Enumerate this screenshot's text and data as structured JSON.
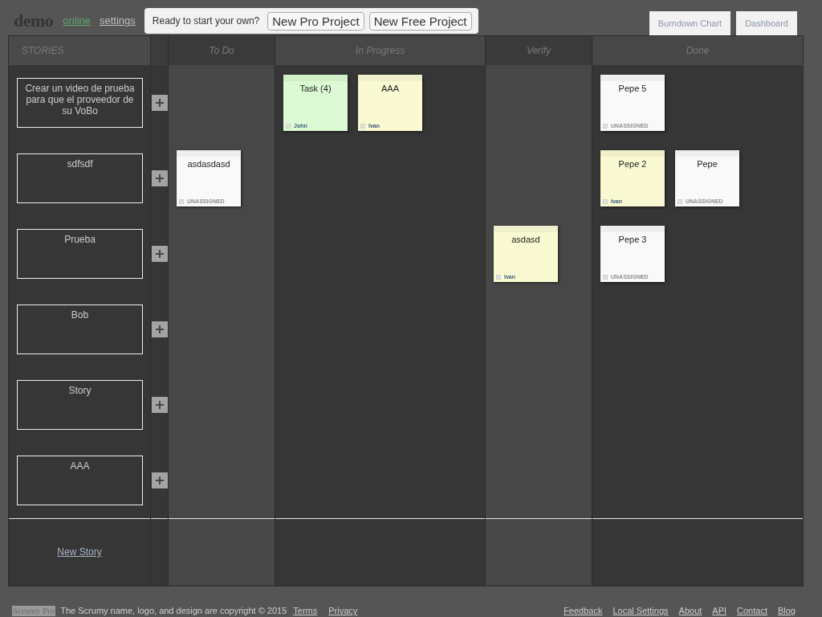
{
  "header": {
    "logo": "demo",
    "status_link": "online",
    "settings_link": "settings"
  },
  "promo": {
    "text": "Ready to start your own?",
    "buttons": [
      "New Pro Project",
      "New Free Project"
    ]
  },
  "view_tabs": [
    "Burndown Chart",
    "Dashboard"
  ],
  "board": {
    "stories_heading": "STORIES",
    "columns": [
      "To Do",
      "In Progress",
      "Verify",
      "Done"
    ],
    "rows": [
      {
        "story": "Crear un video de prueba para que el proveedor de su VoBo",
        "cells": [
          {},
          {
            "tasks": [
              {
                "title": "Task (4)",
                "assignee": "John",
                "assigned": true,
                "color": "#dcfad4"
              },
              {
                "title": "AAA",
                "assignee": "Ivan",
                "assigned": true,
                "color": "#fafad2"
              }
            ]
          },
          {},
          {
            "tasks": [
              {
                "title": "Pepe 5",
                "assignee": "UNASSIGNED",
                "assigned": false,
                "color": "#f9f9f9"
              }
            ]
          }
        ]
      },
      {
        "story": "sdfsdf",
        "cells": [
          {
            "tasks": [
              {
                "title": "asdasdasd",
                "assignee": "UNASSIGNED",
                "assigned": false,
                "color": "#f9f9f9"
              }
            ]
          },
          {},
          {},
          {
            "tasks": [
              {
                "title": "Pepe 2",
                "assignee": "Ivan",
                "assigned": true,
                "color": "#fafad2"
              },
              {
                "title": "Pepe",
                "assignee": "UNASSIGNED",
                "assigned": false,
                "color": "#f9f9f9"
              }
            ]
          }
        ]
      },
      {
        "story": "Prueba",
        "cells": [
          {},
          {},
          {
            "tasks": [
              {
                "title": "asdasd",
                "assignee": "Ivan",
                "assigned": true,
                "color": "#fafad2"
              }
            ]
          },
          {
            "tasks": [
              {
                "title": "Pepe 3",
                "assignee": "UNASSIGNED",
                "assigned": false,
                "color": "#f9f9f9"
              }
            ]
          }
        ]
      },
      {
        "story": "Bob",
        "cells": [
          {},
          {},
          {},
          {}
        ]
      },
      {
        "story": "Story",
        "cells": [
          {},
          {},
          {},
          {}
        ]
      },
      {
        "story": "AAA",
        "cells": [
          {},
          {},
          {},
          {}
        ]
      }
    ],
    "new_story_link": "New Story"
  },
  "footer": {
    "brand": "Scrumy Pro",
    "copyright": "The Scrumy name, logo, and design are copyright © 2015",
    "left_links": [
      "Terms",
      "Privacy"
    ],
    "right_links": [
      "Feedback",
      "Local Settings",
      "About",
      "API",
      "Contact",
      "Blog"
    ]
  }
}
